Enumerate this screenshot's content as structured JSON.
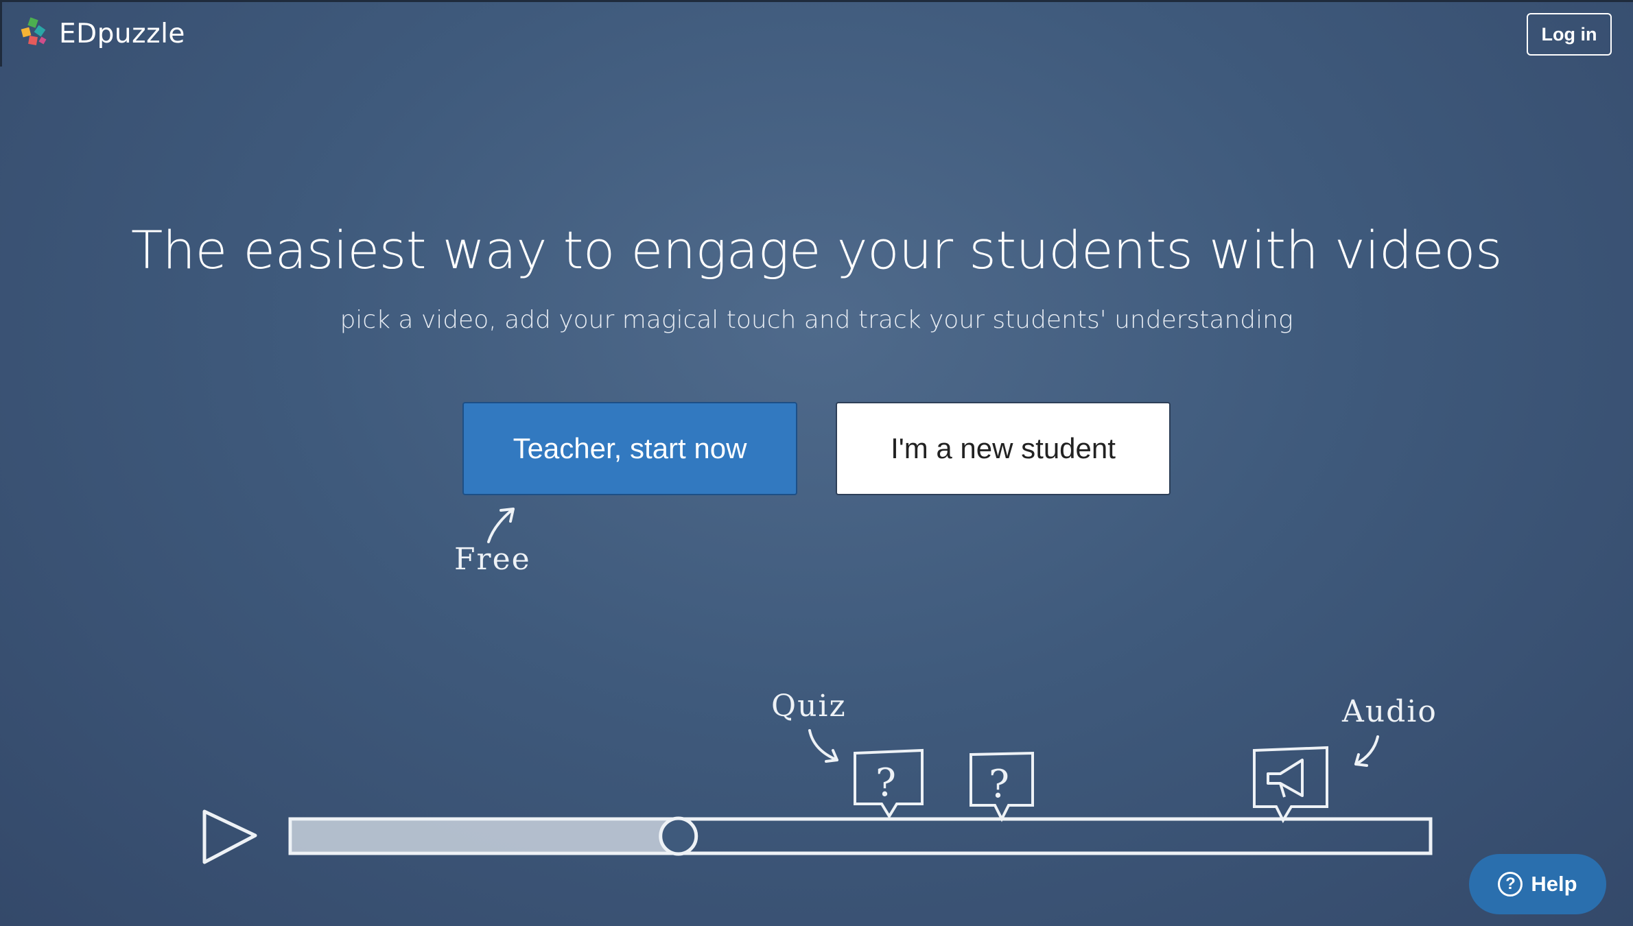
{
  "header": {
    "brand": "EDpuzzle",
    "login_label": "Log in"
  },
  "hero": {
    "title": "The easiest way to engage your students with videos",
    "subtitle": "pick a video, add your magical touch and track your students' understanding",
    "teacher_button": "Teacher, start now",
    "student_button": "I'm a new student",
    "free_note": "Free"
  },
  "illustration": {
    "quiz_label": "Quiz",
    "audio_label": "Audio",
    "progress_fraction": 0.34
  },
  "help": {
    "label": "Help",
    "icon": "question-circle-icon"
  },
  "colors": {
    "background": "#3f5a7c",
    "primary": "#3279c0",
    "help": "#2a6fae"
  }
}
